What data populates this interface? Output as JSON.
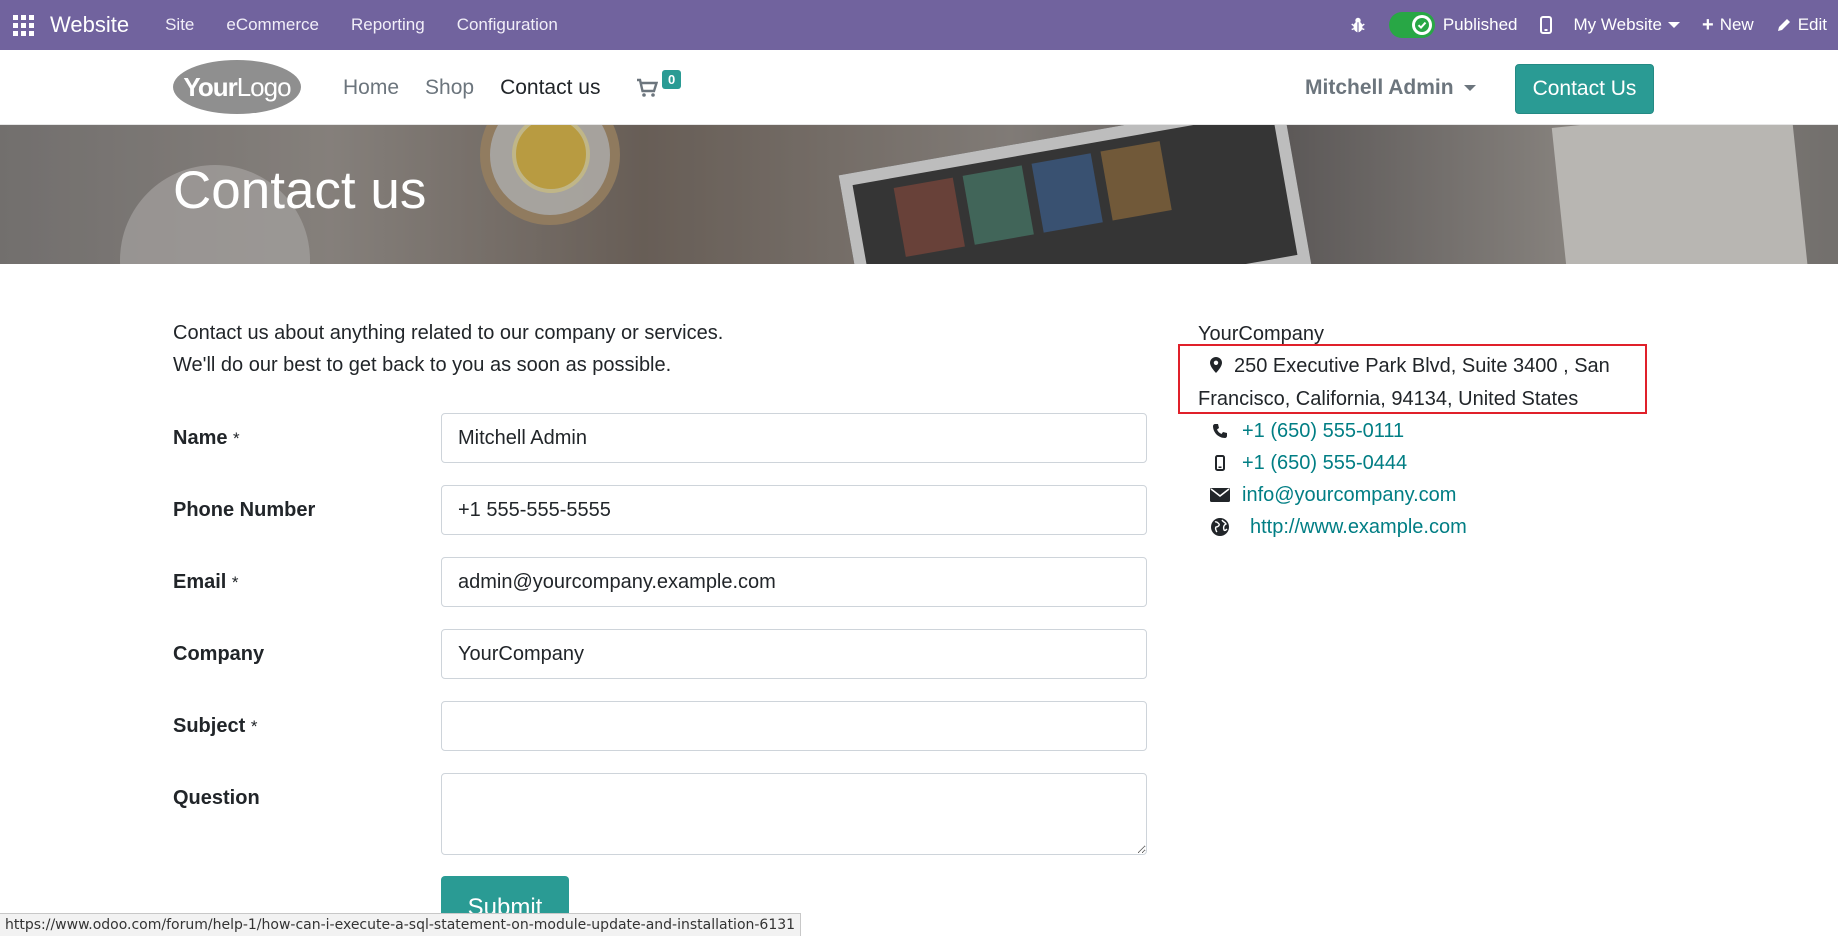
{
  "adminbar": {
    "brand": "Website",
    "menu": [
      "Site",
      "eCommerce",
      "Reporting",
      "Configuration"
    ],
    "published_label": "Published",
    "website_selector": "My Website",
    "new_label": "New",
    "edit_label": "Edit",
    "colors": {
      "bar": "#71639e",
      "toggle": "#28a745"
    }
  },
  "header": {
    "logo_text_bold": "Your",
    "logo_text_light": "Logo",
    "nav": [
      "Home",
      "Shop",
      "Contact us"
    ],
    "active_nav": "Contact us",
    "cart_count": "0",
    "user": "Mitchell Admin",
    "cta": "Contact Us",
    "colors": {
      "primary": "#2a9b94"
    }
  },
  "banner": {
    "title": "Contact us"
  },
  "intro": {
    "line1": "Contact us about anything related to our company or services.",
    "line2": "We'll do our best to get back to you as soon as possible."
  },
  "form": {
    "name_label": "Name",
    "name_value": "Mitchell Admin",
    "phone_label": "Phone Number",
    "phone_value": "+1 555-555-5555",
    "email_label": "Email",
    "email_value": "admin@yourcompany.example.com",
    "company_label": "Company",
    "company_value": "YourCompany",
    "subject_label": "Subject",
    "subject_value": "",
    "question_label": "Question",
    "question_value": "",
    "required_mark": "*",
    "submit_label": "Submit"
  },
  "company": {
    "name": "YourCompany",
    "address_line1": "250 Executive Park Blvd, Suite 3400 , San",
    "address_line2": "Francisco, California, 94134, United States",
    "phone": "+1 (650) 555-0111",
    "mobile": "+1 (650) 555-0444",
    "email": "info@yourcompany.com",
    "website": "http://www.example.com",
    "colors": {
      "link": "#017e84",
      "highlight_box": "#e0202a"
    }
  },
  "statusbar": {
    "url": "https://www.odoo.com/forum/help-1/how-can-i-execute-a-sql-statement-on-module-update-and-installation-6131"
  }
}
